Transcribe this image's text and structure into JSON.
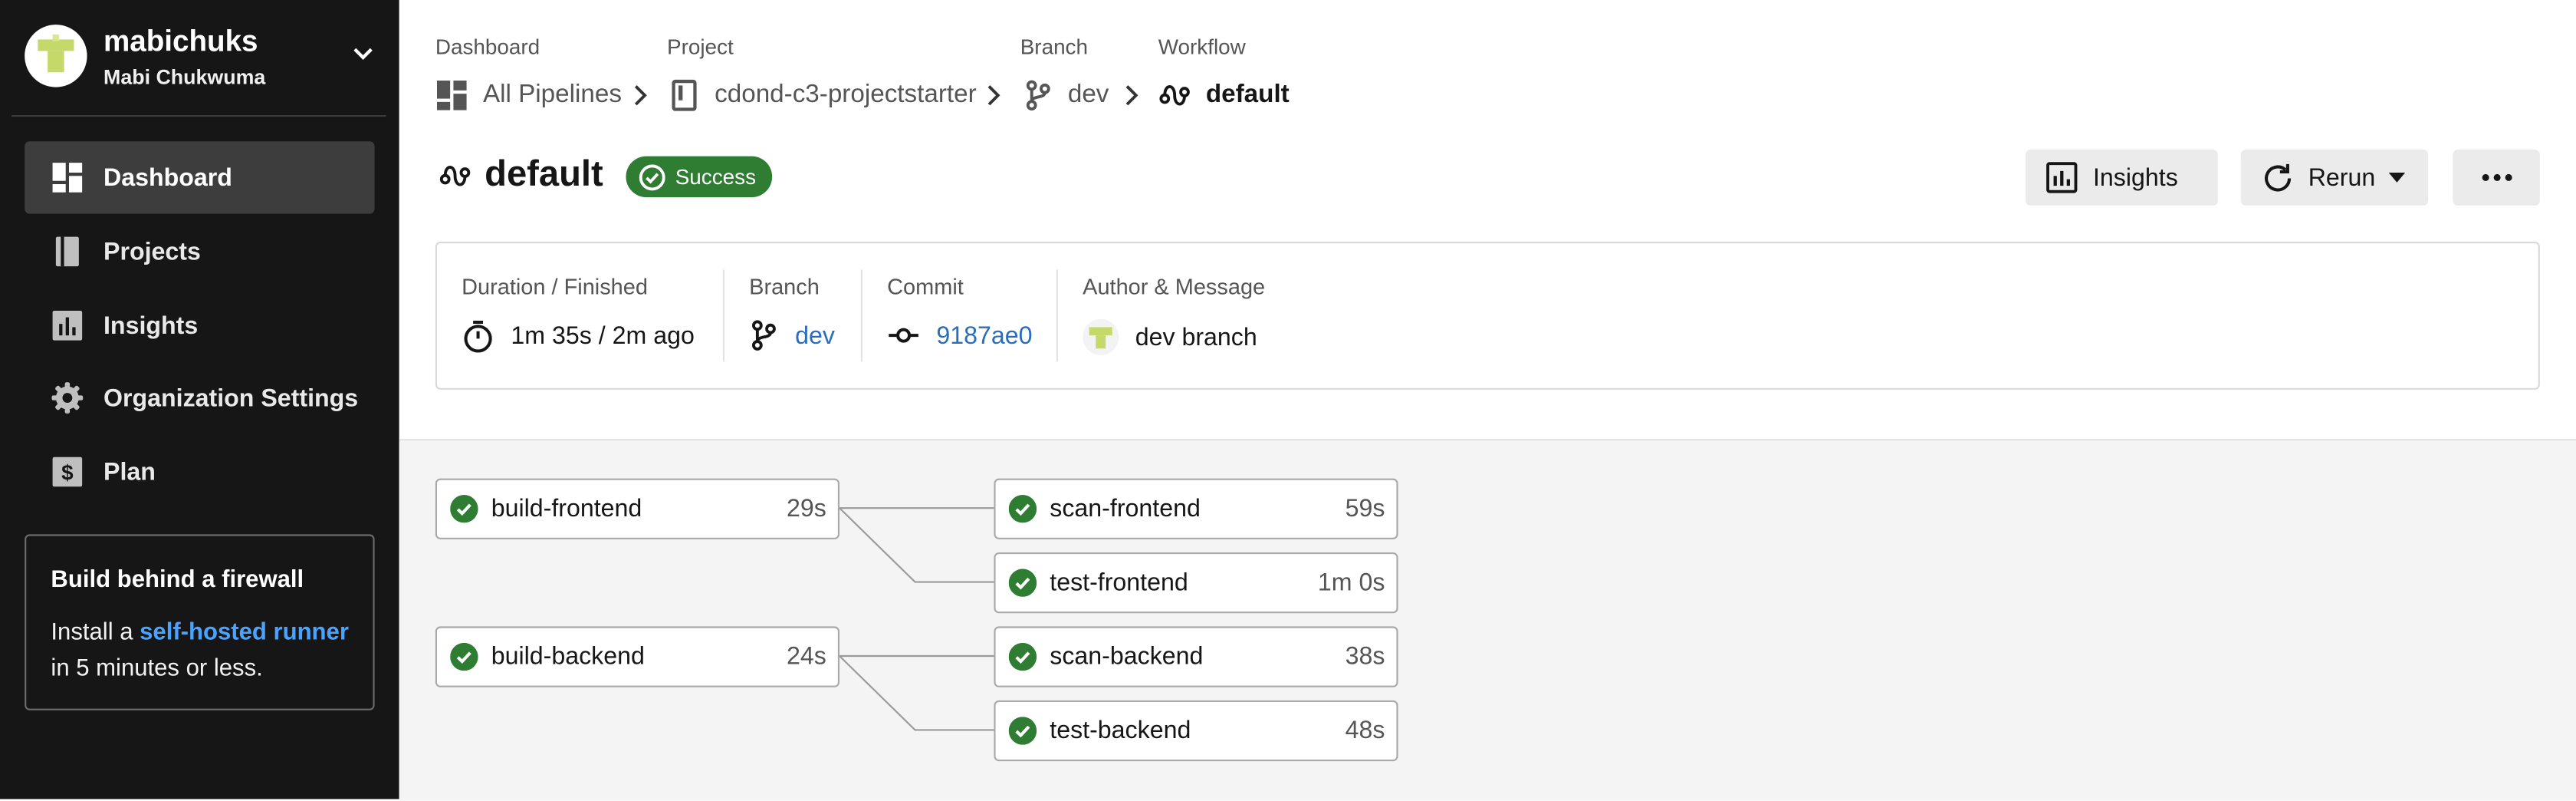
{
  "user": {
    "username": "mabichuks",
    "full_name": "Mabi Chukwuma"
  },
  "nav": {
    "items": [
      {
        "label": "Dashboard",
        "icon": "dashboard-icon",
        "active": true
      },
      {
        "label": "Projects",
        "icon": "projects-icon",
        "active": false
      },
      {
        "label": "Insights",
        "icon": "insights-icon",
        "active": false
      },
      {
        "label": "Organization Settings",
        "icon": "gear-icon",
        "active": false
      },
      {
        "label": "Plan",
        "icon": "dollar-icon",
        "active": false
      }
    ]
  },
  "promo": {
    "title": "Build behind a firewall",
    "text_before": "Install a ",
    "link": "self-hosted runner",
    "text_after": " in 5 minutes or less."
  },
  "breadcrumb": {
    "dashboard_label": "Dashboard",
    "dashboard_value": "All Pipelines",
    "project_label": "Project",
    "project_value": "cdond-c3-projectstarter",
    "branch_label": "Branch",
    "branch_value": "dev",
    "workflow_label": "Workflow",
    "workflow_value": "default"
  },
  "workflow": {
    "title": "default",
    "status": "Success",
    "status_color": "#2e7d32"
  },
  "actions": {
    "insights": "Insights",
    "rerun": "Rerun"
  },
  "summary": {
    "duration_label": "Duration / Finished",
    "duration_value": "1m 35s / 2m ago",
    "branch_label": "Branch",
    "branch_value": "dev",
    "commit_label": "Commit",
    "commit_value": "9187ae0",
    "author_label": "Author & Message",
    "author_value": "dev branch"
  },
  "jobs": {
    "build_frontend": {
      "name": "build-frontend",
      "duration": "29s"
    },
    "scan_frontend": {
      "name": "scan-frontend",
      "duration": "59s"
    },
    "test_frontend": {
      "name": "test-frontend",
      "duration": "1m 0s"
    },
    "build_backend": {
      "name": "build-backend",
      "duration": "24s"
    },
    "scan_backend": {
      "name": "scan-backend",
      "duration": "38s"
    },
    "test_backend": {
      "name": "test-backend",
      "duration": "48s"
    }
  },
  "colors": {
    "sidebar": "#161616",
    "success": "#2e7d32",
    "link": "#2a6ebb",
    "promo_link": "#4aa3ff"
  }
}
